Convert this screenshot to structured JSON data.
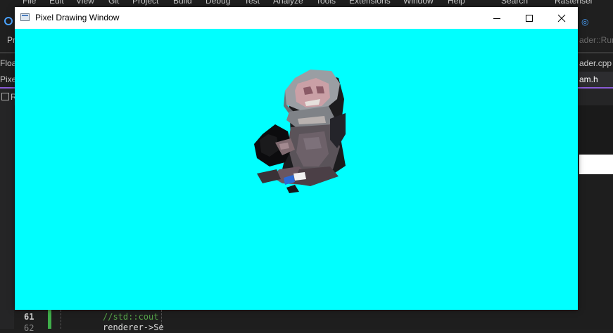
{
  "ide": {
    "menu": [
      "File",
      "Edit",
      "View",
      "Git",
      "Project",
      "Build",
      "Debug",
      "Test",
      "Analyze",
      "Tools",
      "Extensions",
      "Window",
      "Help",
      "Search",
      "Rasterisei"
    ],
    "toolbar_left": "Pr",
    "toolbar_right": "ader::Run",
    "tab_row1_left": "Float",
    "tab_row1_right": "ader.cpp",
    "tab_row2_left": "Pixe",
    "tab_row2_right": "am.h",
    "tab_row3_left": "R",
    "code": {
      "line1_number": "61",
      "line1_text": "//std::cout",
      "line2_number": "62",
      "line2_text": "renderer->Se"
    }
  },
  "window": {
    "title": "Pixel Drawing Window",
    "canvas_color": "#00ffff",
    "controls": [
      "minimize-icon",
      "maximize-icon",
      "close-icon"
    ]
  }
}
